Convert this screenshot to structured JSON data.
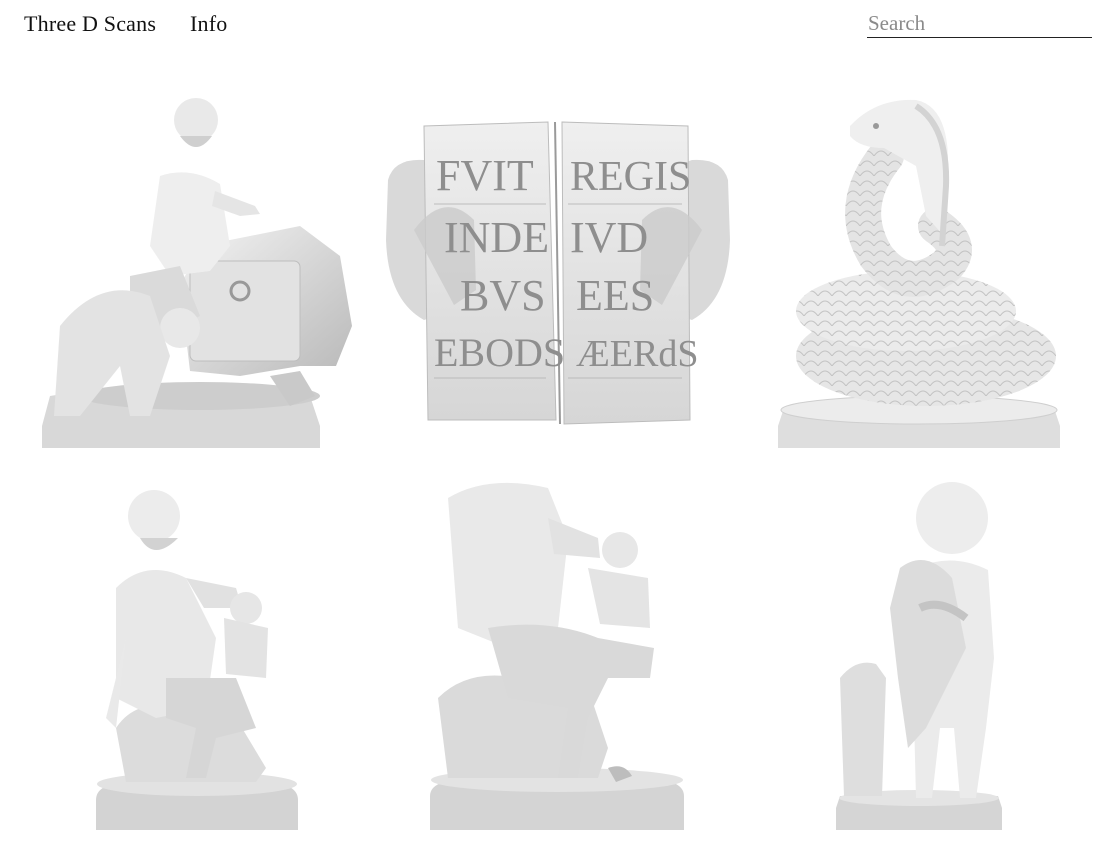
{
  "header": {
    "site_title": "Three D Scans",
    "info_label": "Info",
    "search_placeholder": "Search",
    "search_value": ""
  },
  "gallery": {
    "tablet_inscription": {
      "left_lines": [
        "FVIT",
        "INDE",
        "BVS",
        "EBODS"
      ],
      "right_lines": [
        "REGIS",
        "IVD",
        "EES",
        "ÆERdS"
      ]
    }
  }
}
